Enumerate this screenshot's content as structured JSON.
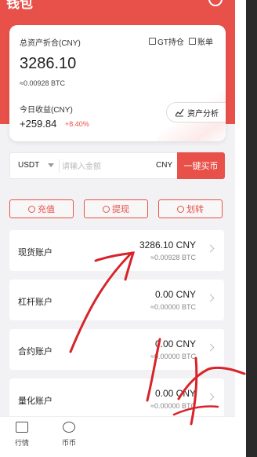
{
  "header": {
    "title": "钱包"
  },
  "asset_card": {
    "total_label": "总资产折合(CNY)",
    "gt_label": "GT持仓",
    "account_label": "账单",
    "total_value": "3286.10",
    "btc_value": "≈0.00928 BTC",
    "today_label": "今日收益(CNY)",
    "today_value": "+259.84",
    "today_pct": "+8.40%",
    "analysis_label": "资产分析"
  },
  "buy": {
    "coin": "USDT",
    "placeholder": "请输入金额",
    "currency": "CNY",
    "button": "一键买币"
  },
  "actions": {
    "deposit": "充值",
    "withdraw": "提现",
    "transfer": "划转"
  },
  "accounts": [
    {
      "label": "现货账户",
      "value": "3286.10 CNY",
      "sub": "≈0.00928 BTC"
    },
    {
      "label": "杠杆账户",
      "value": "0.00 CNY",
      "sub": "≈0.00000 BTC"
    },
    {
      "label": "合约账户",
      "value": "0.00 CNY",
      "sub": "≈0.00000 BTC"
    },
    {
      "label": "量化账户",
      "value": "0.00 CNY",
      "sub": "≈0.00000 BTC"
    }
  ],
  "tabs": [
    {
      "label": "行情"
    },
    {
      "label": "币币"
    }
  ],
  "colors": {
    "brand_red": "#e8514a"
  }
}
